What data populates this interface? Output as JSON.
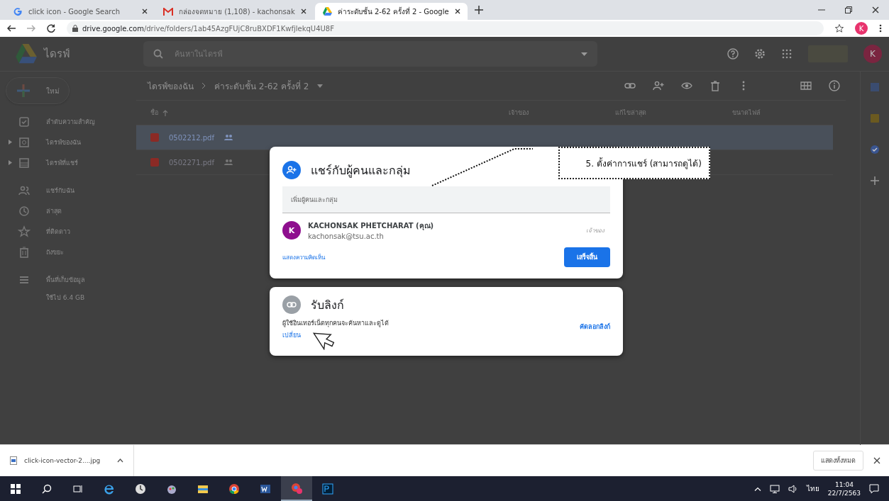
{
  "browser": {
    "tabs": [
      {
        "title": "click icon - Google Search",
        "kind": "google",
        "selected": false
      },
      {
        "title": "กล่องจดหมาย (1,108) - kachonsak",
        "kind": "gmail",
        "selected": false
      },
      {
        "title": "ค่าระดับชั้น 2-62 ครั้งที่ 2 - Google",
        "kind": "drive",
        "selected": true
      }
    ],
    "url_host": "drive.google.com",
    "url_path": "/drive/folders/1ab45AzgFUjC8ruBXDF1KwfjlekqU4U8F",
    "profile_initial": "K"
  },
  "drive": {
    "app_name": "ไดรฟ์",
    "search": {
      "placeholder": "ค้นหาในไดรฟ์"
    },
    "account_initial": "K",
    "new_button": "ใหม่",
    "sidebar": {
      "items": [
        {
          "label": "ลำดับความสำคัญ",
          "kind": "priority",
          "expandable": false
        },
        {
          "label": "ไดรฟ์ของฉัน",
          "kind": "my-drive",
          "expandable": true
        },
        {
          "label": "ไดรฟ์ที่แชร์",
          "kind": "shared-drives",
          "expandable": true
        },
        {
          "label": "แชร์กับฉัน",
          "kind": "shared",
          "expandable": false
        },
        {
          "label": "ล่าสุด",
          "kind": "recent",
          "expandable": false
        },
        {
          "label": "ที่ติดดาว",
          "kind": "starred",
          "expandable": false
        },
        {
          "label": "ถังขยะ",
          "kind": "trash",
          "expandable": false
        },
        {
          "label": "พื้นที่เก็บข้อมูล",
          "kind": "storage",
          "expandable": false
        }
      ],
      "storage_used": "ใช้ไป 6.4 GB"
    },
    "breadcrumb": [
      "ไดรฟ์ของฉัน",
      "ค่าระดับชั้น 2-62 ครั้งที่ 2"
    ],
    "columns": [
      "ชื่อ",
      "เจ้าของ",
      "แก้ไขล่าสุด",
      "ขนาดไฟล์"
    ],
    "files": [
      {
        "name": "0502212.pdf",
        "selected": true
      },
      {
        "name": "0502271.pdf",
        "selected": false
      }
    ]
  },
  "share_dialog": {
    "title": "แชร์กับผู้คนและกลุ่ม",
    "field": {
      "placeholder": "เพิ่มผู้คนและกลุ่ม"
    },
    "person": {
      "initial": "K",
      "name": "KACHONSAK PHETCHARAT (คุณ)",
      "email": "kachonsak@tsu.ac.th",
      "role": "เจ้าของ"
    },
    "feedback_link": "แสดงความคิดเห็น",
    "done_button": "เสร็จสิ้น",
    "link_title": "รับลิงก์",
    "link_access": "ผู้ใช้อินเทอร์เน็ตทุกคนจะค้นหาและดูได้",
    "change_link": "เปลี่ยน",
    "copy_link": "คัดลอกลิงก์"
  },
  "callout": {
    "text": "5. ตั้งค่าการแชร์ (สามารถดูได้)"
  },
  "downloads": {
    "file": "click-icon-vector-2....jpg",
    "show_all": "แสดงทั้งหมด"
  },
  "taskbar": {
    "apps": [
      {
        "kind": "ie",
        "selected": false
      },
      {
        "kind": "clock",
        "selected": false
      },
      {
        "kind": "paint",
        "selected": false
      },
      {
        "kind": "explorer",
        "selected": false
      },
      {
        "kind": "chrome",
        "selected": false
      },
      {
        "kind": "word",
        "selected": false
      },
      {
        "kind": "chrome-profile",
        "selected": true
      },
      {
        "kind": "photoshop",
        "selected": false
      }
    ],
    "language": "ไทย",
    "time": "11:04",
    "date": "22/7/2563"
  }
}
